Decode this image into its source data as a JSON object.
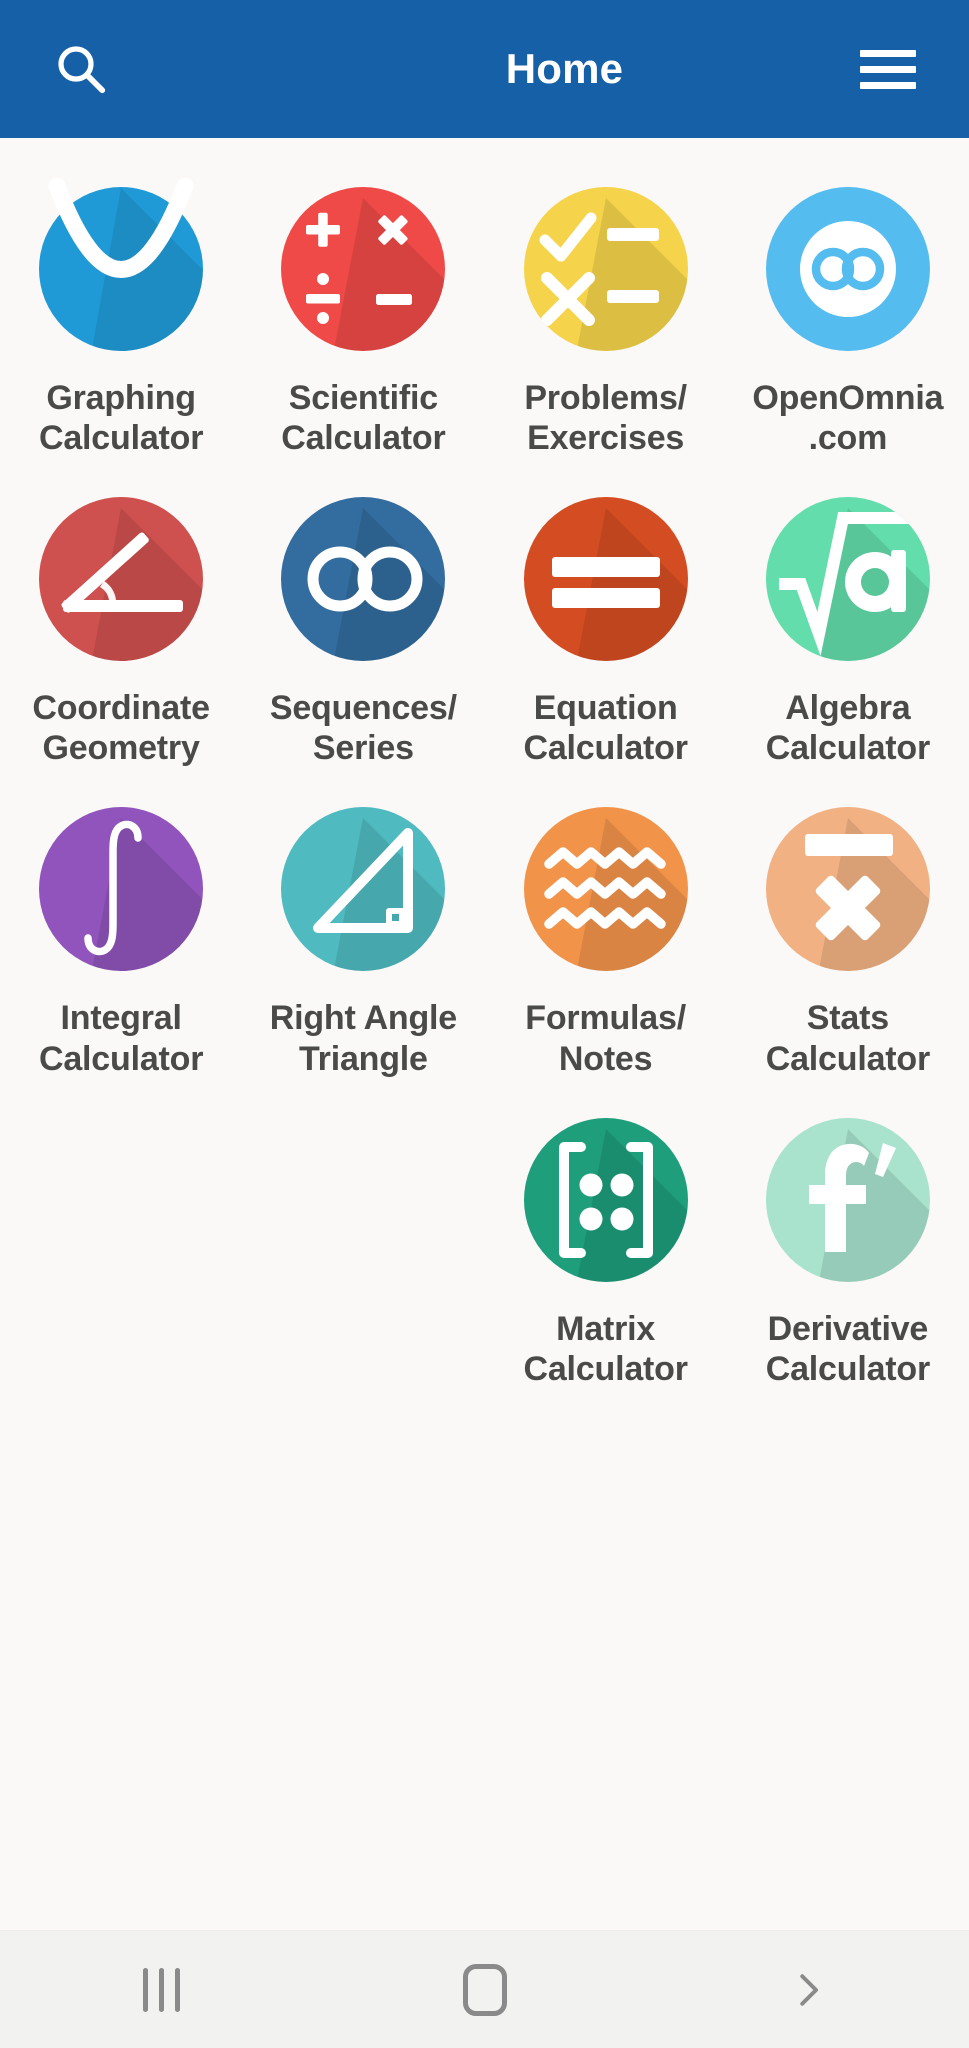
{
  "appbar": {
    "search_icon": "search-icon",
    "title": "Home",
    "menu_icon": "hamburger-menu-icon",
    "background_color": "#1660A8",
    "text_color": "#FFFFFF"
  },
  "page": {
    "background_color": "#FAF9F7",
    "label_color": "#4A4A48"
  },
  "grid": {
    "columns": 4,
    "items": [
      {
        "id": "graphing-calculator",
        "label": "Graphing\nCalculator",
        "icon": "parabola-graph-icon",
        "color": "#1F9AD6"
      },
      {
        "id": "scientific-calculator",
        "label": "Scientific\nCalculator",
        "icon": "arithmetic-operators-icon",
        "color": "#EF4A47"
      },
      {
        "id": "problems-exercises",
        "label": "Problems/\nExercises",
        "icon": "checklist-icon",
        "color": "#F5D44B"
      },
      {
        "id": "openomnia-com",
        "label": "OpenOmnia\n.com",
        "icon": "infinity-badge-icon",
        "color": "#55BCF0"
      },
      {
        "id": "coordinate-geometry",
        "label": "Coordinate\nGeometry",
        "icon": "angle-icon",
        "color": "#CE5150"
      },
      {
        "id": "sequences-series",
        "label": "Sequences/\nSeries",
        "icon": "infinity-outline-icon",
        "color": "#336C9E"
      },
      {
        "id": "equation-calculator",
        "label": "Equation\nCalculator",
        "icon": "equals-icon",
        "color": "#D44D22"
      },
      {
        "id": "algebra-calculator",
        "label": "Algebra\nCalculator",
        "icon": "square-root-a-icon",
        "color": "#62DDAB"
      },
      {
        "id": "integral-calculator",
        "label": "Integral\nCalculator",
        "icon": "integral-icon",
        "color": "#9054BC"
      },
      {
        "id": "right-angle-triangle",
        "label": "Right Angle\nTriangle",
        "icon": "right-triangle-icon",
        "color": "#4FBAC0"
      },
      {
        "id": "formulas-notes",
        "label": "Formulas/\nNotes",
        "icon": "zigzag-lines-icon",
        "color": "#F2934A"
      },
      {
        "id": "stats-calculator",
        "label": "Stats\nCalculator",
        "icon": "x-bar-mean-icon",
        "color": "#F2B183"
      },
      {
        "id": "empty-slot-1",
        "label": "",
        "icon": "",
        "color": ""
      },
      {
        "id": "empty-slot-2",
        "label": "",
        "icon": "",
        "color": ""
      },
      {
        "id": "matrix-calculator",
        "label": "Matrix\nCalculator",
        "icon": "matrix-brackets-icon",
        "color": "#1F9E7C"
      },
      {
        "id": "derivative-calculator",
        "label": "Derivative\nCalculator",
        "icon": "f-prime-icon",
        "color": "#A9E3CE"
      }
    ]
  },
  "navbar": {
    "recents_label": "recent-apps",
    "home_label": "home",
    "back_label": "back",
    "background_color": "#F2F2F0",
    "icon_color": "#8A8A8A"
  }
}
